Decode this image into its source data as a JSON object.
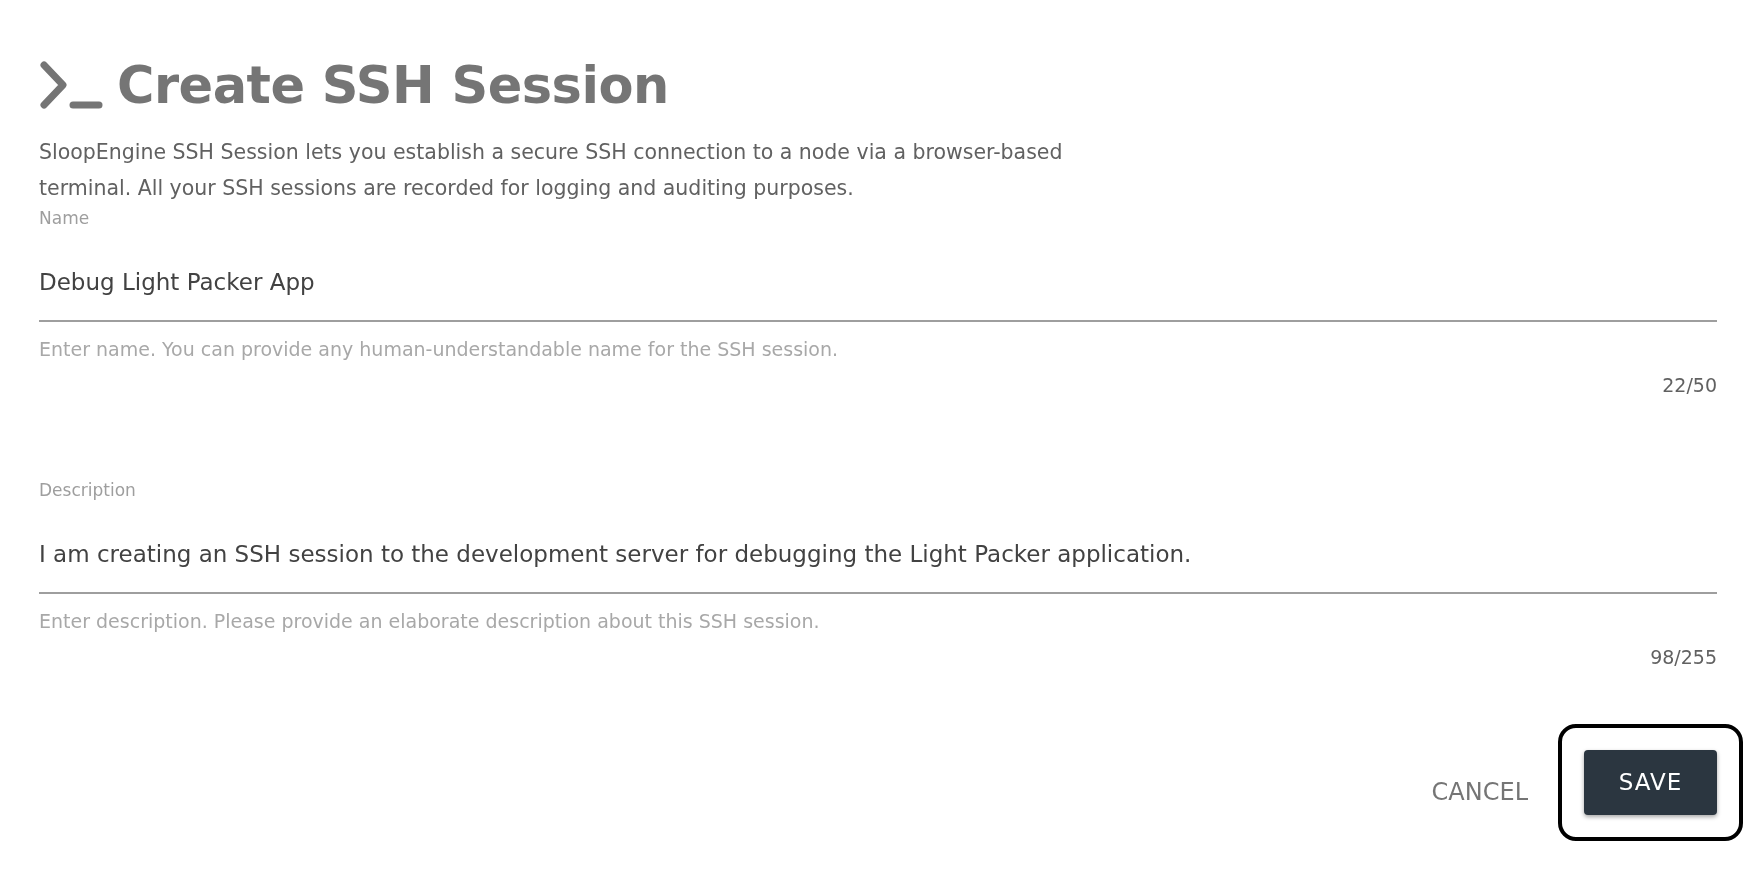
{
  "title": "Create SSH Session",
  "intro": "SloopEngine SSH Session lets you establish a secure SSH connection to a node via a browser-based terminal. All your SSH sessions are recorded for logging and auditing purposes.",
  "fields": [
    {
      "label": "Name",
      "value": "Debug Light Packer App",
      "helper": "Enter name. You can provide any human-understandable name for the SSH session.",
      "counter": "22/50"
    },
    {
      "label": "Description",
      "value": "I am creating an SSH session to the development server for debugging the Light Packer application.",
      "helper": "Enter description. Please provide an elaborate description about this SSH session.",
      "counter": "98/255"
    }
  ],
  "buttons": [
    {
      "kind": "text",
      "label": "CANCEL",
      "focused": false
    },
    {
      "kind": "contained",
      "label": "SAVE",
      "focused": true
    }
  ]
}
